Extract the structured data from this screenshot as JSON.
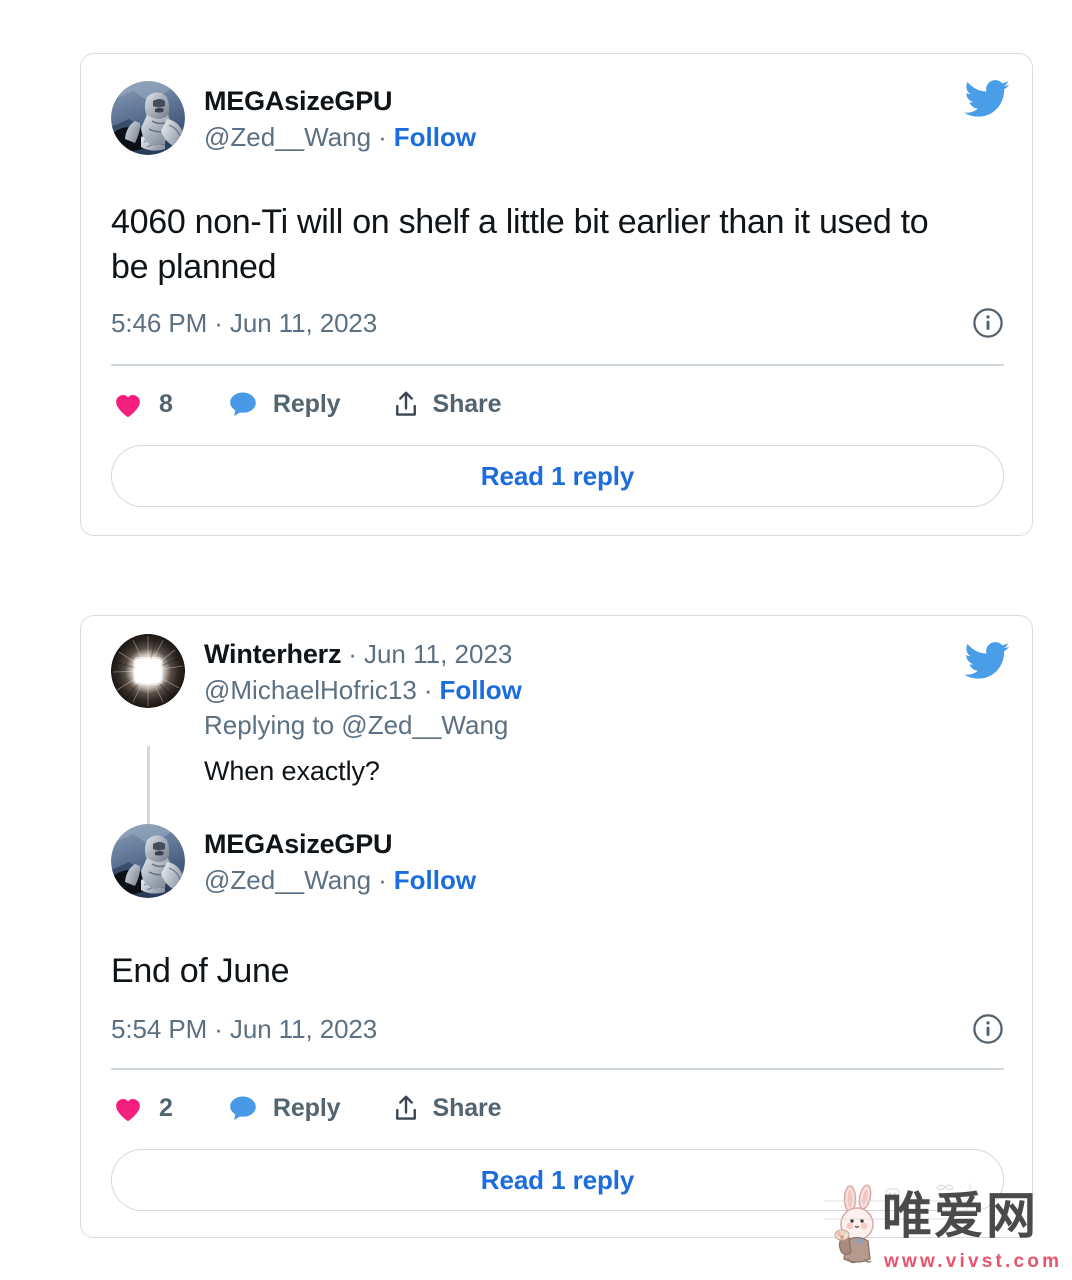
{
  "page": {
    "background_color": "#ffffff",
    "accent_blue": "#1b6ddf",
    "twitter_blue": "#1da1f2",
    "like_pink": "#f91880",
    "reply_blue": "#4a99e9",
    "muted_text": "#5b7083",
    "border_color": "#cfd9de"
  },
  "cards": [
    {
      "id": "tweet-card-1",
      "bird_icon": "twitter-bird-icon",
      "author": {
        "avatar": "knight-armor-avatar",
        "display_name": "MEGAsizeGPU",
        "handle": "@Zed__Wang",
        "separator": "·",
        "follow_label": "Follow"
      },
      "body": "4060 non-Ti will on shelf a little bit earlier than it used to be planned",
      "timestamp": "5:46 PM · Jun 11, 2023",
      "info_icon": "info-circle-icon",
      "actions": {
        "like_icon": "heart-icon",
        "like_count": "8",
        "reply_icon": "speech-bubble-icon",
        "reply_label": "Reply",
        "share_icon": "share-upload-icon",
        "share_label": "Share"
      },
      "read_reply_label": "Read 1 reply"
    },
    {
      "id": "tweet-card-2",
      "bird_icon": "twitter-bird-icon",
      "quoted_author": {
        "avatar": "dark-eye-glow-avatar",
        "display_name": "Winterherz",
        "separator": "·",
        "date": "Jun 11, 2023",
        "handle": "@MichaelHofric13",
        "follow_label": "Follow",
        "replying_to": "Replying to @Zed__Wang",
        "reply_text": "When exactly?"
      },
      "author": {
        "avatar": "knight-armor-avatar",
        "display_name": "MEGAsizeGPU",
        "handle": "@Zed__Wang",
        "separator": "·",
        "follow_label": "Follow"
      },
      "body": "End of June",
      "timestamp": "5:54 PM · Jun 11, 2023",
      "info_icon": "info-circle-icon",
      "actions": {
        "like_icon": "heart-icon",
        "like_count": "2",
        "reply_icon": "speech-bubble-icon",
        "reply_label": "Reply",
        "share_icon": "share-upload-icon",
        "share_label": "Share"
      },
      "read_reply_label": "Read 1 reply"
    }
  ],
  "watermark": {
    "icon": "rabbit-mascot-icon",
    "brand_cn": "唯爱网",
    "url": "www.vivst.com",
    "url_color": "#e8546b"
  }
}
